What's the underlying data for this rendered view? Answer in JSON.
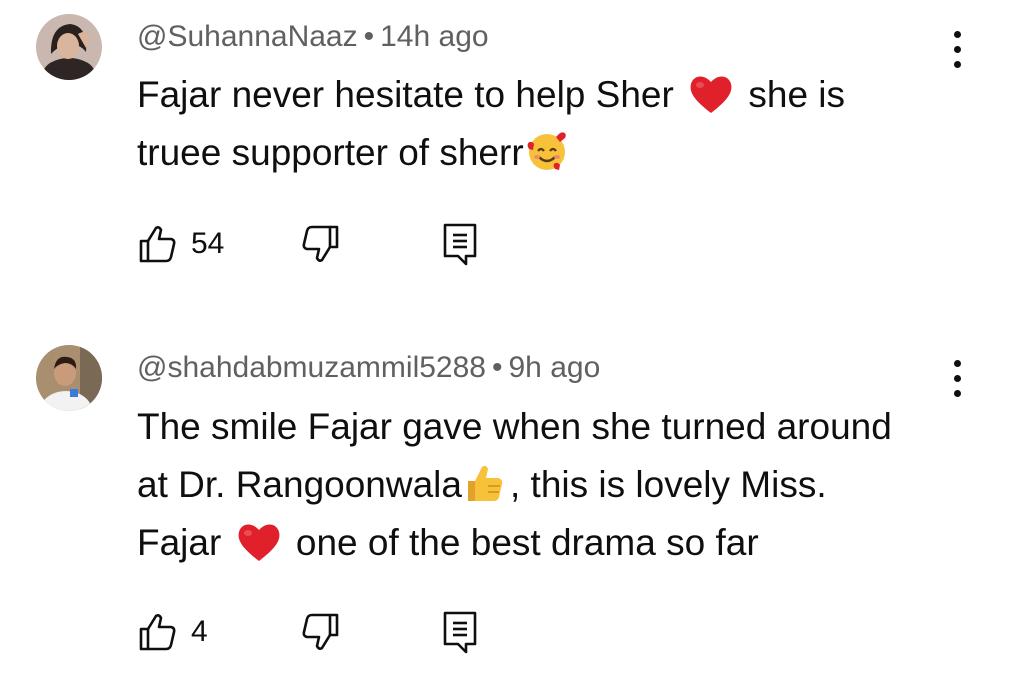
{
  "comments": [
    {
      "username": "@SuhannaNaaz",
      "separator": "•",
      "time": "14h ago",
      "lines": [
        [
          "Fajar never hesitate to help Sher",
          "heart",
          "she is"
        ],
        [
          "truee supporter of sherr",
          "smiling-face-with-hearts",
          ""
        ]
      ],
      "likes": "54",
      "avatar_colors": {
        "bg": "#c9b7b0",
        "face": "#d9b59e",
        "hair": "#2a201d"
      }
    },
    {
      "username": "@shahdabmuzammil5288",
      "separator": "•",
      "time": "9h ago",
      "lines": [
        [
          "The smile Fajar gave when she turned around",
          "",
          ""
        ],
        [
          "at Dr. Rangoonwala",
          "thumbs-up",
          ", this is lovely Miss."
        ],
        [
          "Fajar",
          "heart",
          "one of the best drama so far"
        ]
      ],
      "likes": "4",
      "avatar_colors": {
        "bg": "#a98f6f",
        "face": "#c99b7a",
        "shirt": "#f2f2f2"
      }
    }
  ],
  "icons": {
    "like": "thumbs-up-outline-icon",
    "dislike": "thumbs-down-outline-icon",
    "reply": "reply-comment-icon",
    "more": "more-vertical-icon"
  },
  "colors": {
    "text": "#0f0f0f",
    "meta": "#606060",
    "heart": "#e0202b",
    "emoji_yellow": "#f7c13a"
  }
}
